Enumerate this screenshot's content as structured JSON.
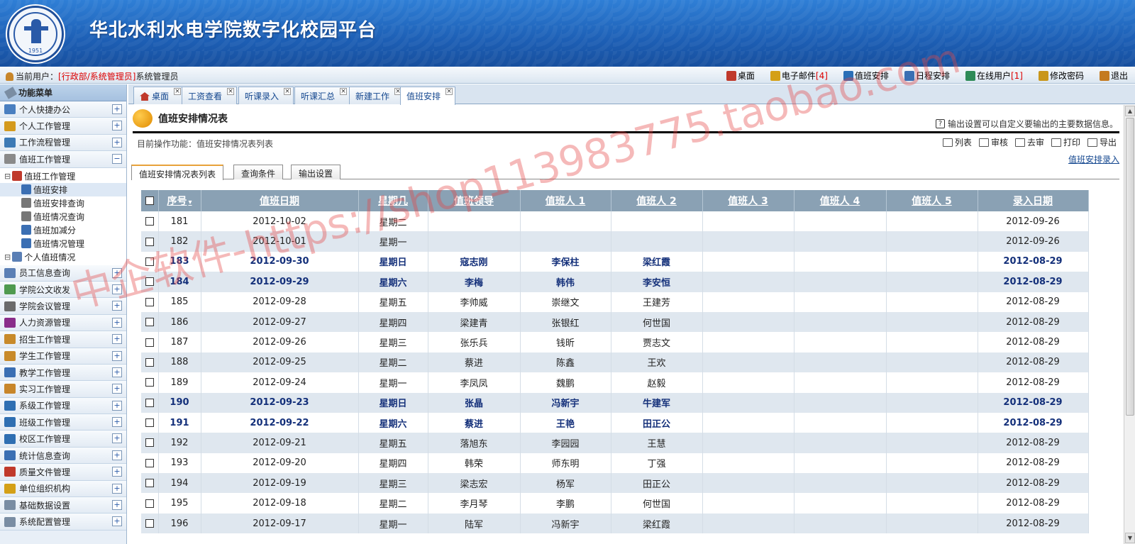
{
  "header": {
    "title": "华北水利水电学院数字化校园平台",
    "logo_year": "1951"
  },
  "topbar": {
    "user_label": "当前用户：",
    "user_dept": "[行政部/系统管理员]",
    "user_name": "系统管理员",
    "links": [
      {
        "label": "桌面",
        "icon": "home-icon",
        "count": ""
      },
      {
        "label": "电子邮件 ",
        "icon": "mail-icon",
        "count": "[4]"
      },
      {
        "label": "值班安排",
        "icon": "chart-icon",
        "count": ""
      },
      {
        "label": "日程安排",
        "icon": "clock-icon",
        "count": ""
      },
      {
        "label": "在线用户 ",
        "icon": "users-icon",
        "count": "[1]"
      },
      {
        "label": "修改密码",
        "icon": "key-icon",
        "count": ""
      },
      {
        "label": "退出",
        "icon": "exit-icon",
        "count": ""
      }
    ]
  },
  "sidebar": {
    "head": "功能菜单",
    "items": [
      {
        "label": "个人快捷办公",
        "icon": "desk-icon",
        "toggle": "+"
      },
      {
        "label": "个人工作管理",
        "icon": "edit-icon",
        "toggle": "+"
      },
      {
        "label": "工作流程管理",
        "icon": "flow-icon",
        "toggle": "+"
      },
      {
        "label": "值班工作管理",
        "icon": "people-icon",
        "toggle": "−"
      }
    ],
    "tree": [
      {
        "label": "值班工作管理",
        "icon": "calendar-icon",
        "level": 0
      },
      {
        "label": "值班安排",
        "icon": "doc-edit-icon",
        "level": 1,
        "selected": true
      },
      {
        "label": "值班安排查询",
        "icon": "search-icon",
        "level": 1
      },
      {
        "label": "值班情况查询",
        "icon": "search-icon",
        "level": 1
      },
      {
        "label": "值班加减分",
        "icon": "doc-edit-icon",
        "level": 1
      },
      {
        "label": "值班情况管理",
        "icon": "doc-edit-icon",
        "level": 1
      },
      {
        "label": "个人值班情况",
        "icon": "person-clock-icon",
        "level": 0
      }
    ],
    "items2": [
      {
        "label": "员工信息查询",
        "icon": "user-icon",
        "toggle": "+"
      },
      {
        "label": "学院公文收发",
        "icon": "docs-icon",
        "toggle": "+"
      },
      {
        "label": "学院会议管理",
        "icon": "meeting-icon",
        "toggle": "+"
      },
      {
        "label": "人力资源管理",
        "icon": "hr-icon",
        "toggle": "+"
      },
      {
        "label": "招生工作管理",
        "icon": "enroll-icon",
        "toggle": "+"
      },
      {
        "label": "学生工作管理",
        "icon": "student-icon",
        "toggle": "+"
      },
      {
        "label": "教学工作管理",
        "icon": "teach-icon",
        "toggle": "+"
      },
      {
        "label": "实习工作管理",
        "icon": "intern-icon",
        "toggle": "+"
      },
      {
        "label": "系级工作管理",
        "icon": "monitor-icon",
        "toggle": "+"
      },
      {
        "label": "班级工作管理",
        "icon": "monitor-icon",
        "toggle": "+"
      },
      {
        "label": "校区工作管理",
        "icon": "monitor-icon",
        "toggle": "+"
      },
      {
        "label": "统计信息查询",
        "icon": "stats-icon",
        "toggle": "+"
      },
      {
        "label": "质量文件管理",
        "icon": "quality-icon",
        "toggle": "+"
      },
      {
        "label": "单位组织机构",
        "icon": "org-icon",
        "toggle": "+"
      },
      {
        "label": "基础数据设置",
        "icon": "tools-icon",
        "toggle": "+"
      },
      {
        "label": "系统配置管理",
        "icon": "tools-icon",
        "toggle": "+"
      }
    ]
  },
  "tabs": [
    {
      "label": "桌面",
      "active": false
    },
    {
      "label": "工资查看",
      "active": false
    },
    {
      "label": "听课录入",
      "active": false
    },
    {
      "label": "听课汇总",
      "active": false
    },
    {
      "label": "新建工作",
      "active": false
    },
    {
      "label": "值班安排",
      "active": true
    }
  ],
  "content": {
    "title": "值班安排情况表",
    "hint": "输出设置可以自定义要输出的主要数据信息。",
    "current_op": "目前操作功能：值班安排情况表列表",
    "actions": [
      "列表",
      "审核",
      "去审",
      "打印",
      "导出"
    ],
    "entry_link": "值班安排录入",
    "subtabs": [
      "值班安排情况表列表",
      "查询条件",
      "输出设置"
    ]
  },
  "table": {
    "columns": [
      "序号",
      "值班日期",
      "星期几",
      "值班领导",
      "值班人 1",
      "值班人 2",
      "值班人 3",
      "值班人 4",
      "值班人 5",
      "录入日期"
    ],
    "rows": [
      {
        "no": "181",
        "date": "2012-10-02",
        "weekday": "星期二",
        "leader": "",
        "p1": "",
        "p2": "",
        "p3": "",
        "p4": "",
        "p5": "",
        "entry": "2012-09-26",
        "hl": false
      },
      {
        "no": "182",
        "date": "2012-10-01",
        "weekday": "星期一",
        "leader": "",
        "p1": "",
        "p2": "",
        "p3": "",
        "p4": "",
        "p5": "",
        "entry": "2012-09-26",
        "hl": false
      },
      {
        "no": "183",
        "date": "2012-09-30",
        "weekday": "星期日",
        "leader": "寇志刚",
        "p1": "李保柱",
        "p2": "梁红霞",
        "p3": "",
        "p4": "",
        "p5": "",
        "entry": "2012-08-29",
        "hl": true
      },
      {
        "no": "184",
        "date": "2012-09-29",
        "weekday": "星期六",
        "leader": "李梅",
        "p1": "韩伟",
        "p2": "李安恒",
        "p3": "",
        "p4": "",
        "p5": "",
        "entry": "2012-08-29",
        "hl": true
      },
      {
        "no": "185",
        "date": "2012-09-28",
        "weekday": "星期五",
        "leader": "李帅威",
        "p1": "崇继文",
        "p2": "王建芳",
        "p3": "",
        "p4": "",
        "p5": "",
        "entry": "2012-08-29",
        "hl": false
      },
      {
        "no": "186",
        "date": "2012-09-27",
        "weekday": "星期四",
        "leader": "梁建青",
        "p1": "张银红",
        "p2": "何世国",
        "p3": "",
        "p4": "",
        "p5": "",
        "entry": "2012-08-29",
        "hl": false
      },
      {
        "no": "187",
        "date": "2012-09-26",
        "weekday": "星期三",
        "leader": "张乐兵",
        "p1": "钱昕",
        "p2": "贾志文",
        "p3": "",
        "p4": "",
        "p5": "",
        "entry": "2012-08-29",
        "hl": false
      },
      {
        "no": "188",
        "date": "2012-09-25",
        "weekday": "星期二",
        "leader": "蔡进",
        "p1": "陈鑫",
        "p2": "王欢",
        "p3": "",
        "p4": "",
        "p5": "",
        "entry": "2012-08-29",
        "hl": false
      },
      {
        "no": "189",
        "date": "2012-09-24",
        "weekday": "星期一",
        "leader": "李凤凤",
        "p1": "魏鹏",
        "p2": "赵毅",
        "p3": "",
        "p4": "",
        "p5": "",
        "entry": "2012-08-29",
        "hl": false
      },
      {
        "no": "190",
        "date": "2012-09-23",
        "weekday": "星期日",
        "leader": "张晶",
        "p1": "冯新宇",
        "p2": "牛建军",
        "p3": "",
        "p4": "",
        "p5": "",
        "entry": "2012-08-29",
        "hl": true
      },
      {
        "no": "191",
        "date": "2012-09-22",
        "weekday": "星期六",
        "leader": "蔡进",
        "p1": "王艳",
        "p2": "田正公",
        "p3": "",
        "p4": "",
        "p5": "",
        "entry": "2012-08-29",
        "hl": true
      },
      {
        "no": "192",
        "date": "2012-09-21",
        "weekday": "星期五",
        "leader": "落旭东",
        "p1": "李园园",
        "p2": "王慧",
        "p3": "",
        "p4": "",
        "p5": "",
        "entry": "2012-08-29",
        "hl": false
      },
      {
        "no": "193",
        "date": "2012-09-20",
        "weekday": "星期四",
        "leader": "韩荣",
        "p1": "师东明",
        "p2": "丁强",
        "p3": "",
        "p4": "",
        "p5": "",
        "entry": "2012-08-29",
        "hl": false
      },
      {
        "no": "194",
        "date": "2012-09-19",
        "weekday": "星期三",
        "leader": "梁志宏",
        "p1": "杨军",
        "p2": "田正公",
        "p3": "",
        "p4": "",
        "p5": "",
        "entry": "2012-08-29",
        "hl": false
      },
      {
        "no": "195",
        "date": "2012-09-18",
        "weekday": "星期二",
        "leader": "李月琴",
        "p1": "李鹏",
        "p2": "何世国",
        "p3": "",
        "p4": "",
        "p5": "",
        "entry": "2012-08-29",
        "hl": false
      },
      {
        "no": "196",
        "date": "2012-09-17",
        "weekday": "星期一",
        "leader": "陆军",
        "p1": "冯新宇",
        "p2": "梁红霞",
        "p3": "",
        "p4": "",
        "p5": "",
        "entry": "2012-08-29",
        "hl": false
      }
    ]
  },
  "watermark": "中企软件-https://shop113983775.taobao.com",
  "colors": {
    "header_blue": "#1d5fb5",
    "table_header": "#8aa1b4",
    "row_alt": "#dfe7ef",
    "highlight_text": "#14307a",
    "accent_red": "#dd0000"
  }
}
